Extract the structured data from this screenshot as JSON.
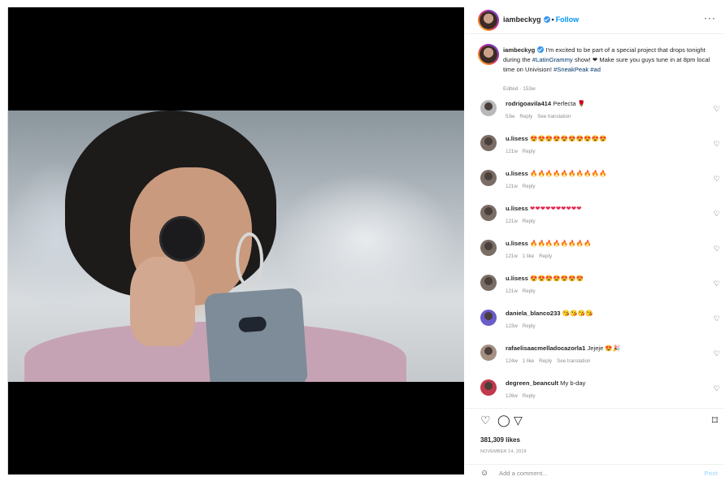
{
  "post": {
    "username": "iambeckyg",
    "follow_label": "Follow",
    "more_label": "···",
    "caption": {
      "username": "iambeckyg",
      "text_1": "I'm excited to be part of a special project that drops tonight during the",
      "hashtag_1": "#LatinGrammy",
      "text_2": "show!",
      "heart": "❤",
      "text_3": "Make sure you guys tune in at 8pm local time on Univision!",
      "hashtag_2": "#SneakPeak",
      "hashtag_3": "#ad",
      "meta": "Edited · 153w"
    },
    "comments": [
      {
        "user": "rodrigoavila414",
        "text": "Perfecta 🌹",
        "time": "53w",
        "likes": "",
        "reply": "Reply",
        "translate": "See translation"
      },
      {
        "user": "u.lisess",
        "text": "😍😍😍😍😍😍😍😍😍😍",
        "time": "121w",
        "likes": "",
        "reply": "Reply",
        "translate": ""
      },
      {
        "user": "u.lisess",
        "text": "🔥🔥🔥🔥🔥🔥🔥🔥🔥🔥",
        "time": "121w",
        "likes": "",
        "reply": "Reply",
        "translate": ""
      },
      {
        "user": "u.lisess",
        "text": "❤❤❤❤❤❤❤❤❤❤",
        "time": "121w",
        "likes": "",
        "reply": "Reply",
        "translate": ""
      },
      {
        "user": "u.lisess",
        "text": "🔥🔥🔥🔥🔥🔥🔥🔥",
        "time": "121w",
        "likes": "1 like",
        "reply": "Reply",
        "translate": ""
      },
      {
        "user": "u.lisess",
        "text": "😍😍😍😍😍😍😍",
        "time": "121w",
        "likes": "",
        "reply": "Reply",
        "translate": ""
      },
      {
        "user": "daniela_blanco233",
        "text": "😘😘😘😘",
        "time": "123w",
        "likes": "",
        "reply": "Reply",
        "translate": ""
      },
      {
        "user": "rafaelisaacmelladocazorla1",
        "text": "Jejeje 😍🎉",
        "time": "124w",
        "likes": "1 like",
        "reply": "Reply",
        "translate": "See translation"
      },
      {
        "user": "degreen_beancult",
        "text": "My b-day",
        "time": "126w",
        "likes": "",
        "reply": "Reply",
        "translate": ""
      }
    ],
    "likes": "381,309 likes",
    "date": "NOVEMBER 14, 2019",
    "add_comment_placeholder": "Add a comment...",
    "post_label": "Post"
  },
  "icons": {
    "heart": "♡",
    "comment": "◯",
    "share": "▽",
    "bookmark": "⌑",
    "smile": "☺"
  }
}
